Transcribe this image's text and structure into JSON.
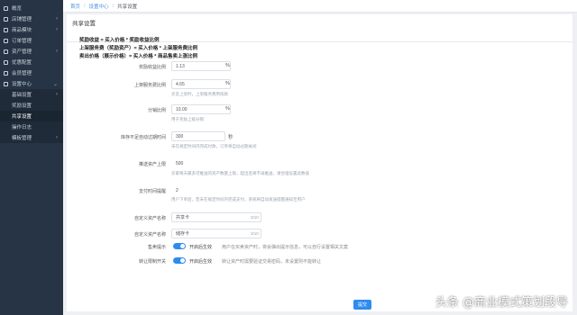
{
  "sidebar": {
    "items": [
      {
        "label": "概览"
      },
      {
        "label": "店铺管理"
      },
      {
        "label": "商品模块"
      },
      {
        "label": "订单管理"
      },
      {
        "label": "资产管理"
      },
      {
        "label": "优惠配置"
      },
      {
        "label": "会员管理"
      },
      {
        "label": "设置中心"
      }
    ],
    "subitems": [
      {
        "label": "基础设置"
      },
      {
        "label": "奖励设置"
      },
      {
        "label": "共享设置"
      },
      {
        "label": "操作日志"
      },
      {
        "label": "模板管理"
      }
    ]
  },
  "breadcrumb": {
    "home": "首页",
    "parent": "设置中心",
    "current": "共享设置"
  },
  "panel": {
    "title": "共享设置",
    "submit": "提交"
  },
  "formulas": [
    "奖励收益 = 买入价格 * 奖励收益比例",
    "上架服务费（奖励资产）= 买入价格 * 上架服务费比例",
    "卖出价格（展示价格）= 买入价格 * 商品售卖上涨比例"
  ],
  "form": {
    "f1": {
      "label": "奖励收益比例",
      "value": "1.13",
      "unit": "%"
    },
    "f2": {
      "label": "上架服务费比例",
      "value": "4.65",
      "unit": "%",
      "hint": "买卖上架时，上架服务费用扣款"
    },
    "f3": {
      "label": "分销比例",
      "value": "10.00",
      "unit": "%",
      "hint": "用于奖励上级分销"
    },
    "f4": {
      "label": "库存不足自动过期时间",
      "value": "300",
      "unit": "秒",
      "hint": "未在规定时间内完成付款，订单将自动过期关闭"
    },
    "f5": {
      "label": "推送资产上限",
      "value": "500",
      "hint": "买家每天最多可推送的资产数量上限，超出后将不再推送，请合理设置此数值"
    },
    "f6": {
      "label": "支付时间提醒",
      "value": "2",
      "hint": "用户下单后，若未在规定时间内完成支付，系统将自动发送提醒通知至用户"
    },
    "f7": {
      "label": "自定义资产名称",
      "value": "共享卡",
      "counter": "3/10"
    },
    "f8": {
      "label": "自定义资产名称",
      "value": "储存卡",
      "counter": "3/10"
    }
  },
  "toggles": {
    "t1": {
      "label": "售卖提示",
      "text": "开启后生效",
      "desc": "用户在买卖资产时，将会弹出提示信息，可以自行设置相关文案"
    },
    "t2": {
      "label": "转让限制开关",
      "text": "开启后生效",
      "desc": "转让资产时需要验证交易密码，未设置则不能转让"
    }
  },
  "watermark": "头条 @商业模式策划段导",
  "colors": {
    "sidebar": "#263445",
    "accent": "#2d8cf0"
  }
}
